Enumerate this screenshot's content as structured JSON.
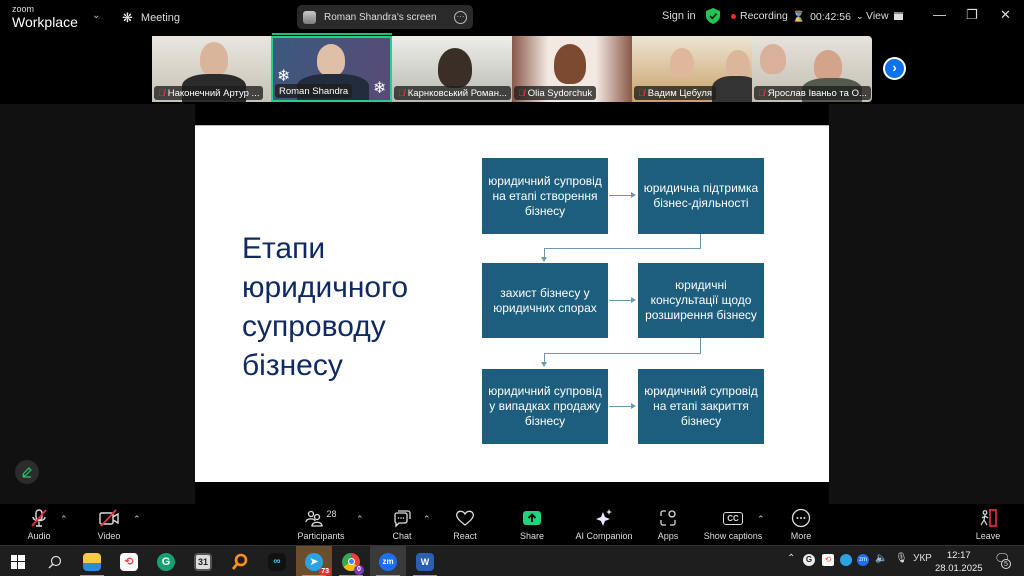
{
  "window": {
    "app_logo_small": "zoom",
    "app_logo_big": "Workplace",
    "meeting_label": "Meeting",
    "share_pill_label": "Roman Shandra's screen",
    "sign_in": "Sign in",
    "recording_label": "Recording",
    "timer": "00:42:56",
    "view_label": "View",
    "controls": {
      "minimize": "—",
      "restore": "❐",
      "close": "✕"
    }
  },
  "participants_strip": [
    {
      "name": "Наконечний Артур ...",
      "muted": true,
      "active": false
    },
    {
      "name": "Roman Shandra",
      "muted": false,
      "active": true
    },
    {
      "name": "Карнковський Роман...",
      "muted": true,
      "active": false
    },
    {
      "name": "Olia Sydorchuk",
      "muted": true,
      "active": false
    },
    {
      "name": "Вадим Цебуля",
      "muted": true,
      "active": false
    },
    {
      "name": "Ярослав Іваньо та О...",
      "muted": true,
      "active": false
    }
  ],
  "slide": {
    "title_lines": [
      "Етапи",
      "юридичного",
      "супроводу",
      "бізнесу"
    ],
    "boxes": [
      "юридичний супровід на етапі створення бізнесу",
      "юридична підтримка бізнес-діяльності",
      "захист бізнесу у юридичних спорах",
      "юридичні консультації щодо розширення бізнесу",
      "юридичний супровід у випадках продажу бізнесу",
      "юридичний супровід на етапі закриття бізнесу"
    ],
    "colors": {
      "title": "#0f2a63",
      "box": "#1d5e7e",
      "connector": "#6c98b0"
    }
  },
  "toolbar": {
    "audio": "Audio",
    "video": "Video",
    "participants": "Participants",
    "participants_count": "28",
    "chat": "Chat",
    "react": "React",
    "share": "Share",
    "ai_companion": "AI Companion",
    "apps": "Apps",
    "captions": "Show captions",
    "captions_icon_text": "CC",
    "more": "More",
    "leave": "Leave"
  },
  "taskbar": {
    "apps": [
      "Start",
      "Search",
      "File Explorer",
      "Sync app",
      "Grammarly",
      "Calendar",
      "Search tool",
      "Webex",
      "Telegram",
      "Chrome",
      "Zoom",
      "Word"
    ],
    "telegram_badge": "73",
    "chrome_badge": "0",
    "zoom_icon_text": "zm",
    "word_icon_text": "W",
    "calendar_icon_text": "31",
    "grammarly_icon_text": "G",
    "tray_language": "УКР",
    "time": "12:17",
    "date": "28.01.2025",
    "notifications_count": "5"
  }
}
